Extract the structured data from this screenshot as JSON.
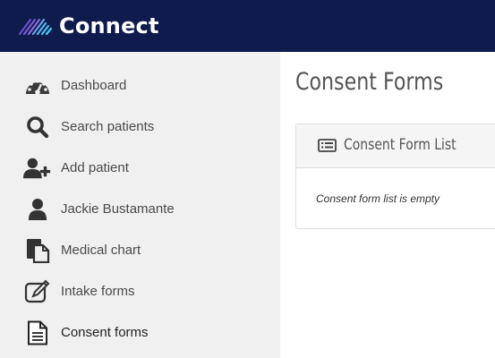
{
  "app": {
    "logo_text": "Connect"
  },
  "sidebar": {
    "items": [
      {
        "label": "Dashboard",
        "icon": "dashboard-gauge-icon"
      },
      {
        "label": "Search patients",
        "icon": "search-icon"
      },
      {
        "label": "Add patient",
        "icon": "add-user-icon"
      },
      {
        "label": "Jackie Bustamante",
        "icon": "user-icon"
      },
      {
        "label": "Medical chart",
        "icon": "clipboard-icon"
      },
      {
        "label": "Intake forms",
        "icon": "edit-form-icon"
      },
      {
        "label": "Consent forms",
        "icon": "document-icon"
      }
    ]
  },
  "main": {
    "title": "Consent Forms",
    "panel": {
      "title": "Consent Form List",
      "icon": "list-icon",
      "empty_message": "Consent form list is empty"
    }
  },
  "colors": {
    "topbar": "#0f1a4d",
    "sidebar": "#f0f0f0",
    "logo_accent": "#7b5cd6"
  }
}
